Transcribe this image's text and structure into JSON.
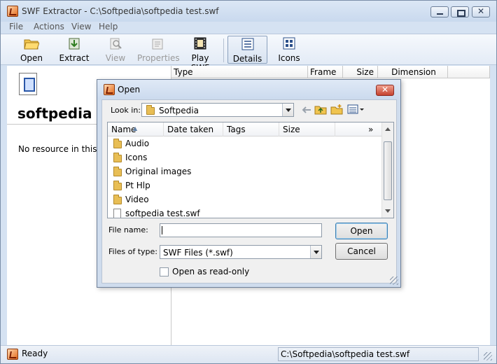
{
  "window": {
    "title": "SWF Extractor - C:\\Softpedia\\softpedia test.swf"
  },
  "menu": [
    "File",
    "Actions",
    "View",
    "Help"
  ],
  "toolbar": {
    "open": "Open",
    "extract": "Extract",
    "view": "View",
    "properties": "Properties",
    "play_swf": "Play SWF",
    "details": "Details",
    "icons": "Icons"
  },
  "left_panel": {
    "title": "softpedia",
    "message": "No resource in this f"
  },
  "columns": [
    "Type",
    "Frame",
    "Size",
    "Dimension"
  ],
  "status": {
    "ready": "Ready",
    "path": "C:\\Softpedia\\softpedia test.swf"
  },
  "dialog": {
    "title": "Open",
    "close_glyph": "✕",
    "look_in_label": "Look in:",
    "look_in_value": "Softpedia",
    "list_headers": [
      "Name",
      "Date taken",
      "Tags",
      "Size"
    ],
    "more_columns": "»",
    "items": [
      {
        "name": "Audio",
        "type": "folder"
      },
      {
        "name": "Icons",
        "type": "folder"
      },
      {
        "name": "Original images",
        "type": "folder"
      },
      {
        "name": "Pt Hlp",
        "type": "folder"
      },
      {
        "name": "Video",
        "type": "folder"
      },
      {
        "name": "softpedia test.swf",
        "type": "file"
      }
    ],
    "file_name_label": "File name:",
    "file_name_value": "",
    "files_of_type_label": "Files of type:",
    "files_of_type_value": "SWF Files (*.swf)",
    "open_button": "Open",
    "cancel_button": "Cancel",
    "readonly_label": "Open as read-only"
  }
}
